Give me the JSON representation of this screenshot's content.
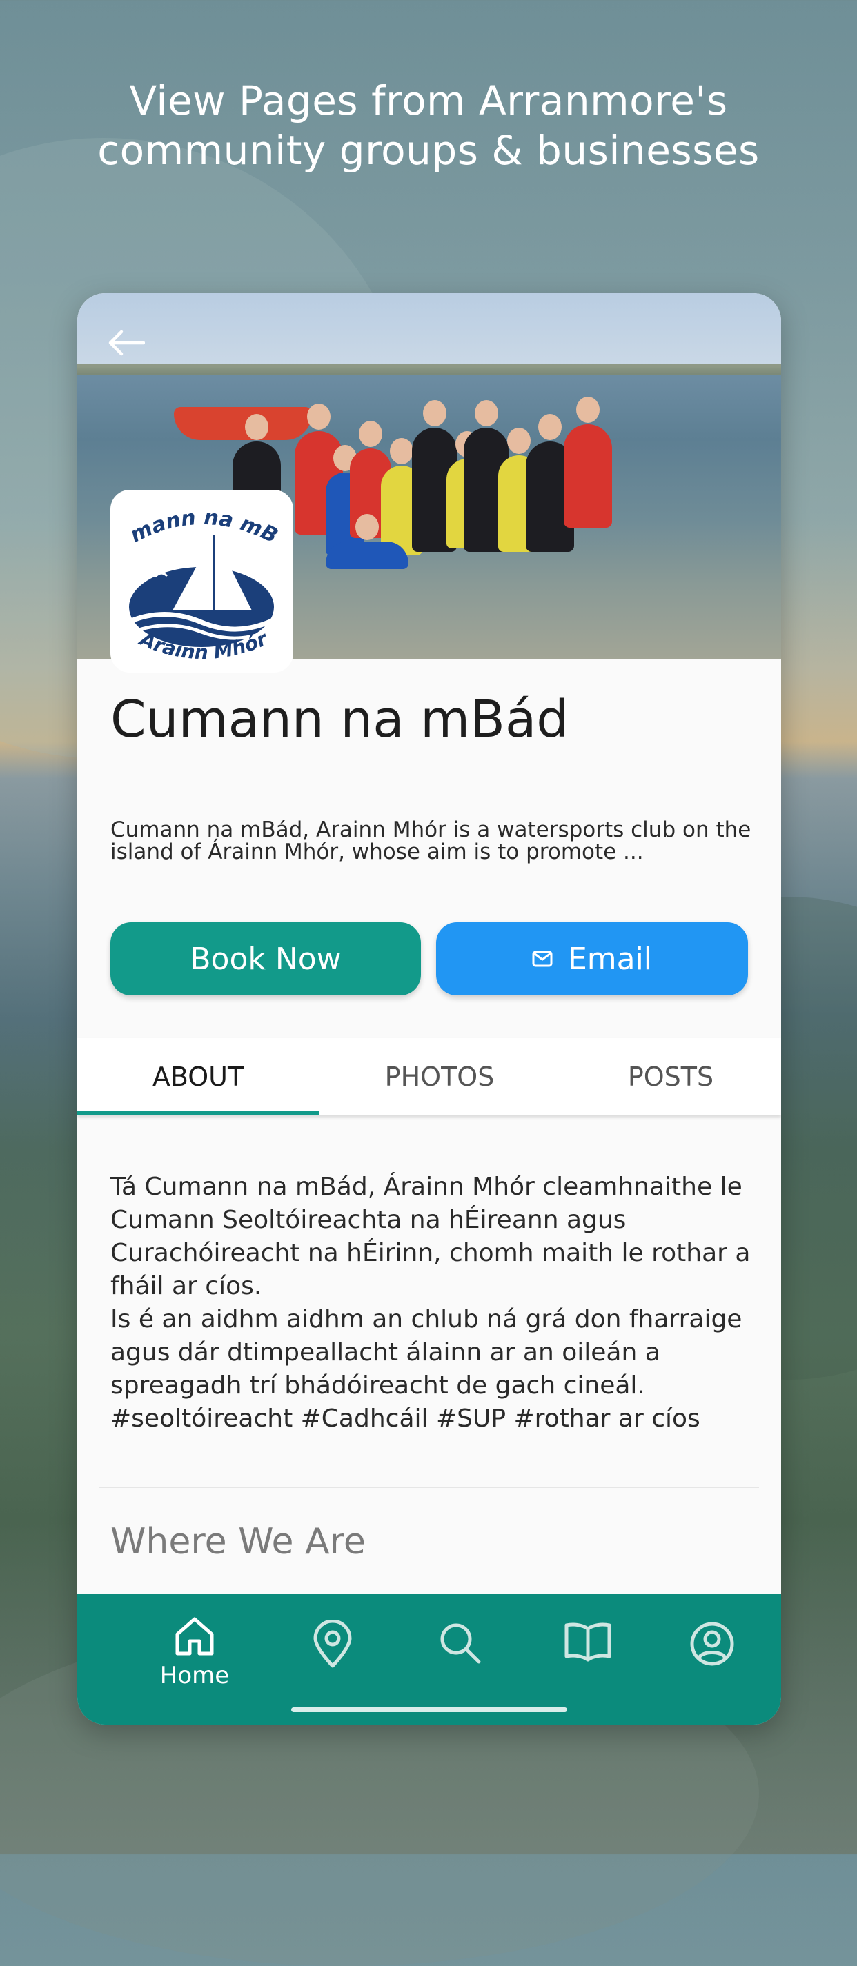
{
  "headline": {
    "line1": "View Pages from Arranmore's",
    "line2": "community groups & businesses"
  },
  "page": {
    "back_icon": "arrow-left-icon",
    "logo": {
      "text_top": "Cumann na mBád",
      "text_bottom": "Arainn Mhór"
    },
    "title": "Cumann na mBád",
    "description": "Cumann na mBád, Arainn Mhór is a watersports club on the island of Árainn Mhór, whose aim is to promote ...",
    "buttons": {
      "book_label": "Book Now",
      "email_label": "Email",
      "email_icon": "mail-icon"
    },
    "tabs": [
      {
        "label": "ABOUT",
        "active": true
      },
      {
        "label": "PHOTOS",
        "active": false
      },
      {
        "label": "POSTS",
        "active": false
      }
    ],
    "about": "Tá Cumann na mBád, Árainn Mhór cleamhnaithe le Cumann Seoltóireachta na hÉireann agus Curachóireacht na hÉirinn, chomh maith le rothar a fháil ar cíos.\nIs é an aidhm aidhm an chlub ná grá don fharraige agus dár dtimpeallacht álainn ar an oileán a spreagadh trí bhádóireacht de gach cineál. #seoltóireacht #Cadhcáil #SUP #rothar ar cíos",
    "section_title": "Where We Are"
  },
  "nav": {
    "items": [
      {
        "icon": "home-icon",
        "label": "Home",
        "active": true
      },
      {
        "icon": "map-pin-icon"
      },
      {
        "icon": "search-icon"
      },
      {
        "icon": "book-open-icon"
      },
      {
        "icon": "user-circle-icon"
      }
    ]
  },
  "colors": {
    "accent": "#129a8a",
    "nav_bg": "#0b8b7c",
    "email_blue": "#2196f3",
    "logo_navy": "#1b3f7a"
  }
}
